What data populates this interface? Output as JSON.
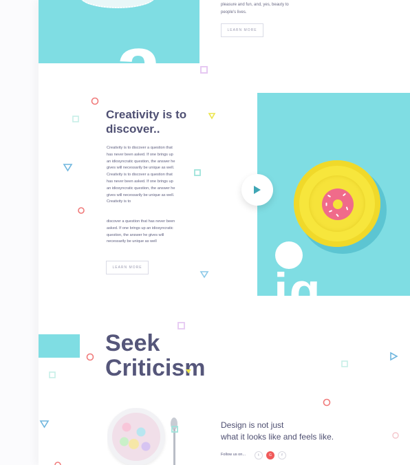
{
  "top": {
    "text": "pleasure and fun, and, yes, beauty to people's lives.",
    "button_label": "LEARN MORE",
    "image_letter": "a"
  },
  "creativity": {
    "title": "Creativity is to discover..",
    "paragraph_1": "Creativity is to discover a question that has never been asked. If one brings up an idiosyncratic question, the answer he gives will necessarily be unique as well. Creativity is to discover a question that has never been asked. If one brings up an idiosyncratic question, the answer he gives will necessarily be unique as well. Creativity is to",
    "paragraph_2": "discover a question that has never been asked. If one brings up an idiosyncratic question, the answer he gives will necessarily be unique as well",
    "button_label": "LEARN MORE",
    "hero_letters": "ig"
  },
  "seek": {
    "title_line_1": "Seek",
    "title_line_2": "Criticism"
  },
  "footer": {
    "tagline_line_1": "Design is not just",
    "tagline_line_2": "what it looks like and feels like.",
    "follow_label": "Follow us on...",
    "social": [
      {
        "name": "twitter",
        "glyph": "t"
      },
      {
        "name": "google",
        "glyph": "G"
      },
      {
        "name": "facebook",
        "glyph": "f"
      }
    ]
  },
  "colors": {
    "accent_cyan": "#7fdde3",
    "title_text": "#4f5073",
    "plate_yellow": "#f7e63c",
    "donut_pink": "#f06b8a",
    "deco_coral": "#f07a7a",
    "deco_blue": "#6fb6de",
    "deco_mint": "#9fe3da",
    "deco_lilac": "#e6c8f2",
    "deco_yellow": "#ece54b"
  }
}
